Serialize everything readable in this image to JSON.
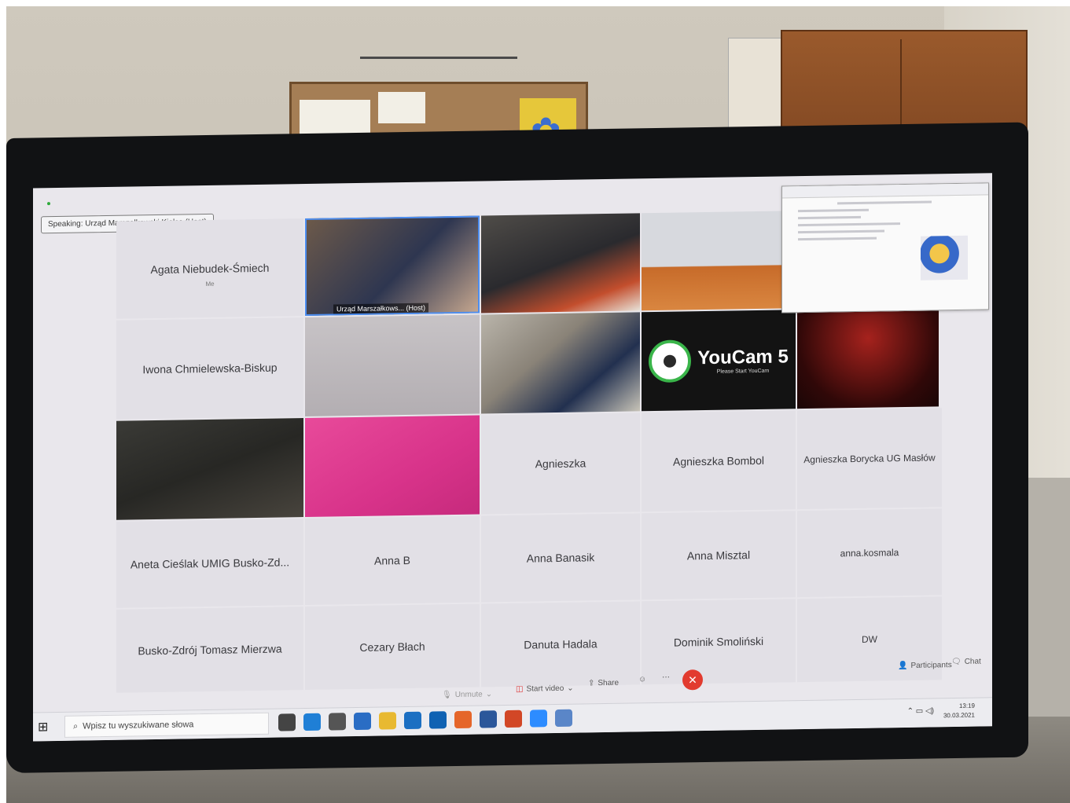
{
  "speaking_banner": "Speaking: Urząd Marszałkowski Kielce (Host)",
  "participants": {
    "agata": {
      "name": "Agata Niebudek-Śmiech",
      "sub": "Me"
    },
    "host_label": "Urząd Marszałkows... (Host)",
    "iwona": "Iwona Chmielewska-Biskup",
    "agnieszka": "Agnieszka",
    "agnieszka_bombol": "Agnieszka Bombol",
    "agnieszka_borycka": "Agnieszka Borycka UG Masłów",
    "aneta": "Aneta Cieślak UMIG Busko-Zd...",
    "anna_b": "Anna B",
    "anna_banasik": "Anna Banasik",
    "anna_misztal": "Anna Misztal",
    "anna_kosmala": "anna.kosmala",
    "busko": "Busko-Zdrój Tomasz Mierzwa",
    "cezary": "Cezary Błach",
    "danuta": "Danuta Hadala",
    "dominik": "Dominik Smoliński",
    "dw": "DW"
  },
  "youcam": {
    "title": "YouCam 5",
    "subtitle": "Please Start YouCam"
  },
  "controls": {
    "unmute": "Unmute",
    "start_video": "Start video",
    "share": "Share",
    "participants": "Participants",
    "chat": "Chat"
  },
  "taskbar": {
    "search_placeholder": "Wpisz tu wyszukiwane słowa",
    "time": "13:19",
    "date": "30.03.2021"
  }
}
